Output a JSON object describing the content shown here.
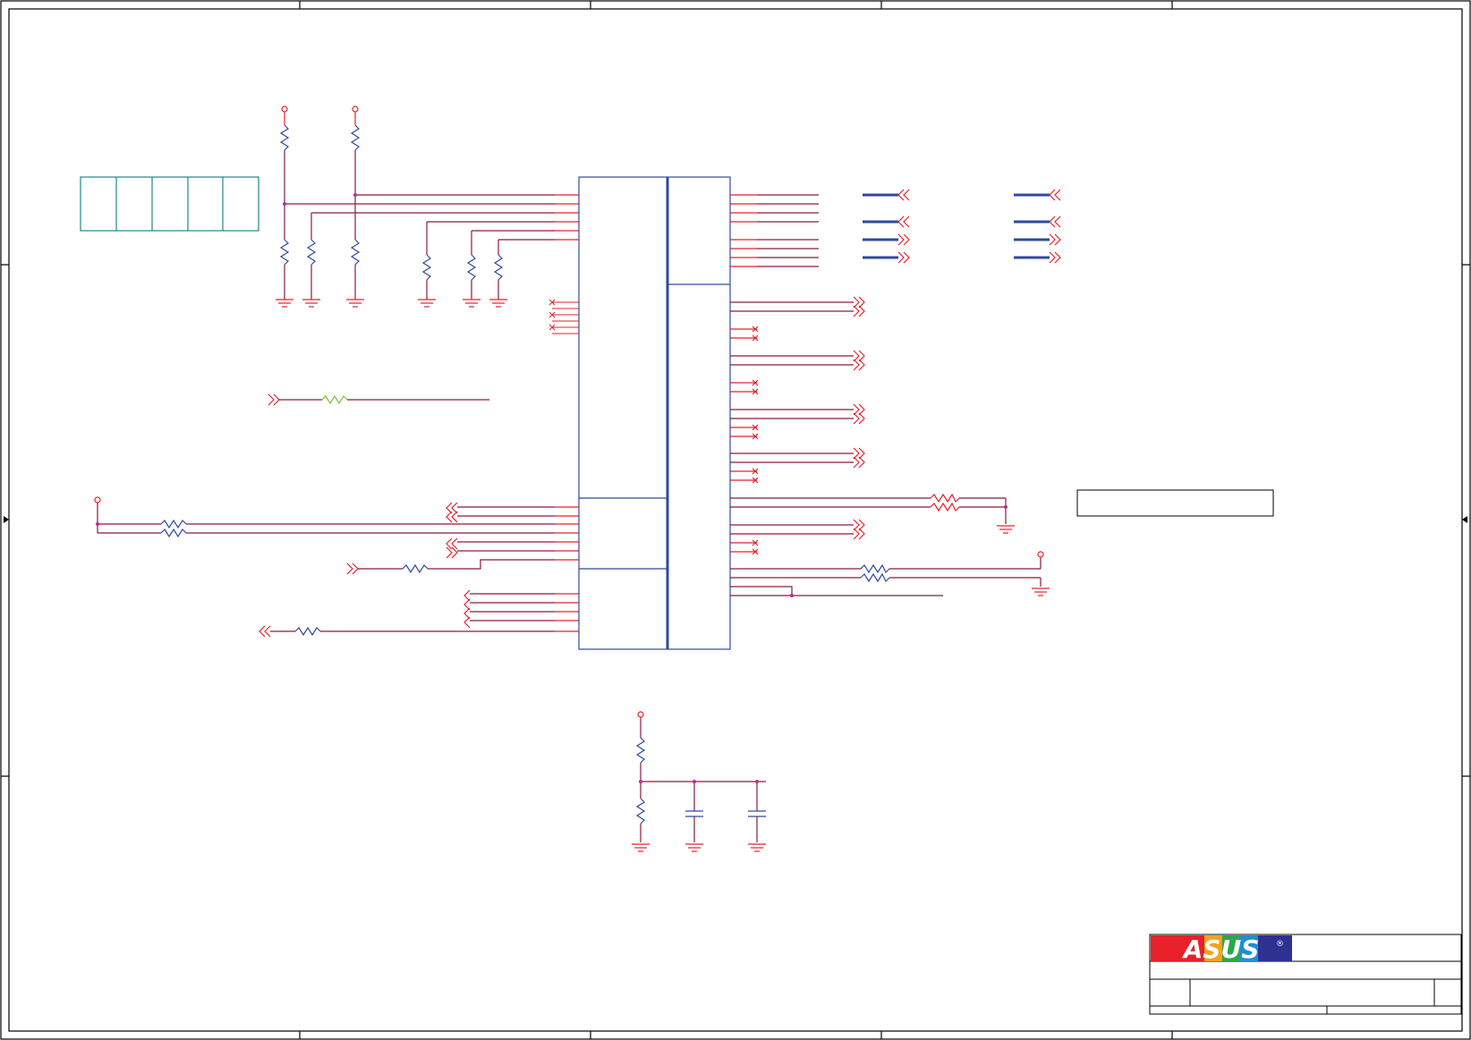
{
  "title_block": {
    "logo": {
      "text": "ASUS",
      "registered_mark": "®",
      "colors": {
        "red": "#e8202a",
        "blue": "#2e3192",
        "white": "#ffffff"
      }
    }
  },
  "colors": {
    "border": "#000000",
    "wire": "#8b1a3a",
    "pin": "#e8202a",
    "component": "#2e4a9e",
    "net_flag": "#e8202a",
    "bus": "#2e4a9e",
    "dip_switch": "#1a8a8a",
    "ferrite": "#7fbf3f",
    "junction": "#b03090"
  },
  "icons": {
    "power_flag": "open-circle-power-symbol",
    "ground": "ground-symbol",
    "resistor": "zigzag-resistor",
    "capacitor": "parallel-plate-capacitor",
    "net_flag_out": "double-chevron-right",
    "net_flag_in": "double-chevron-left",
    "no_connect": "x-mark"
  }
}
